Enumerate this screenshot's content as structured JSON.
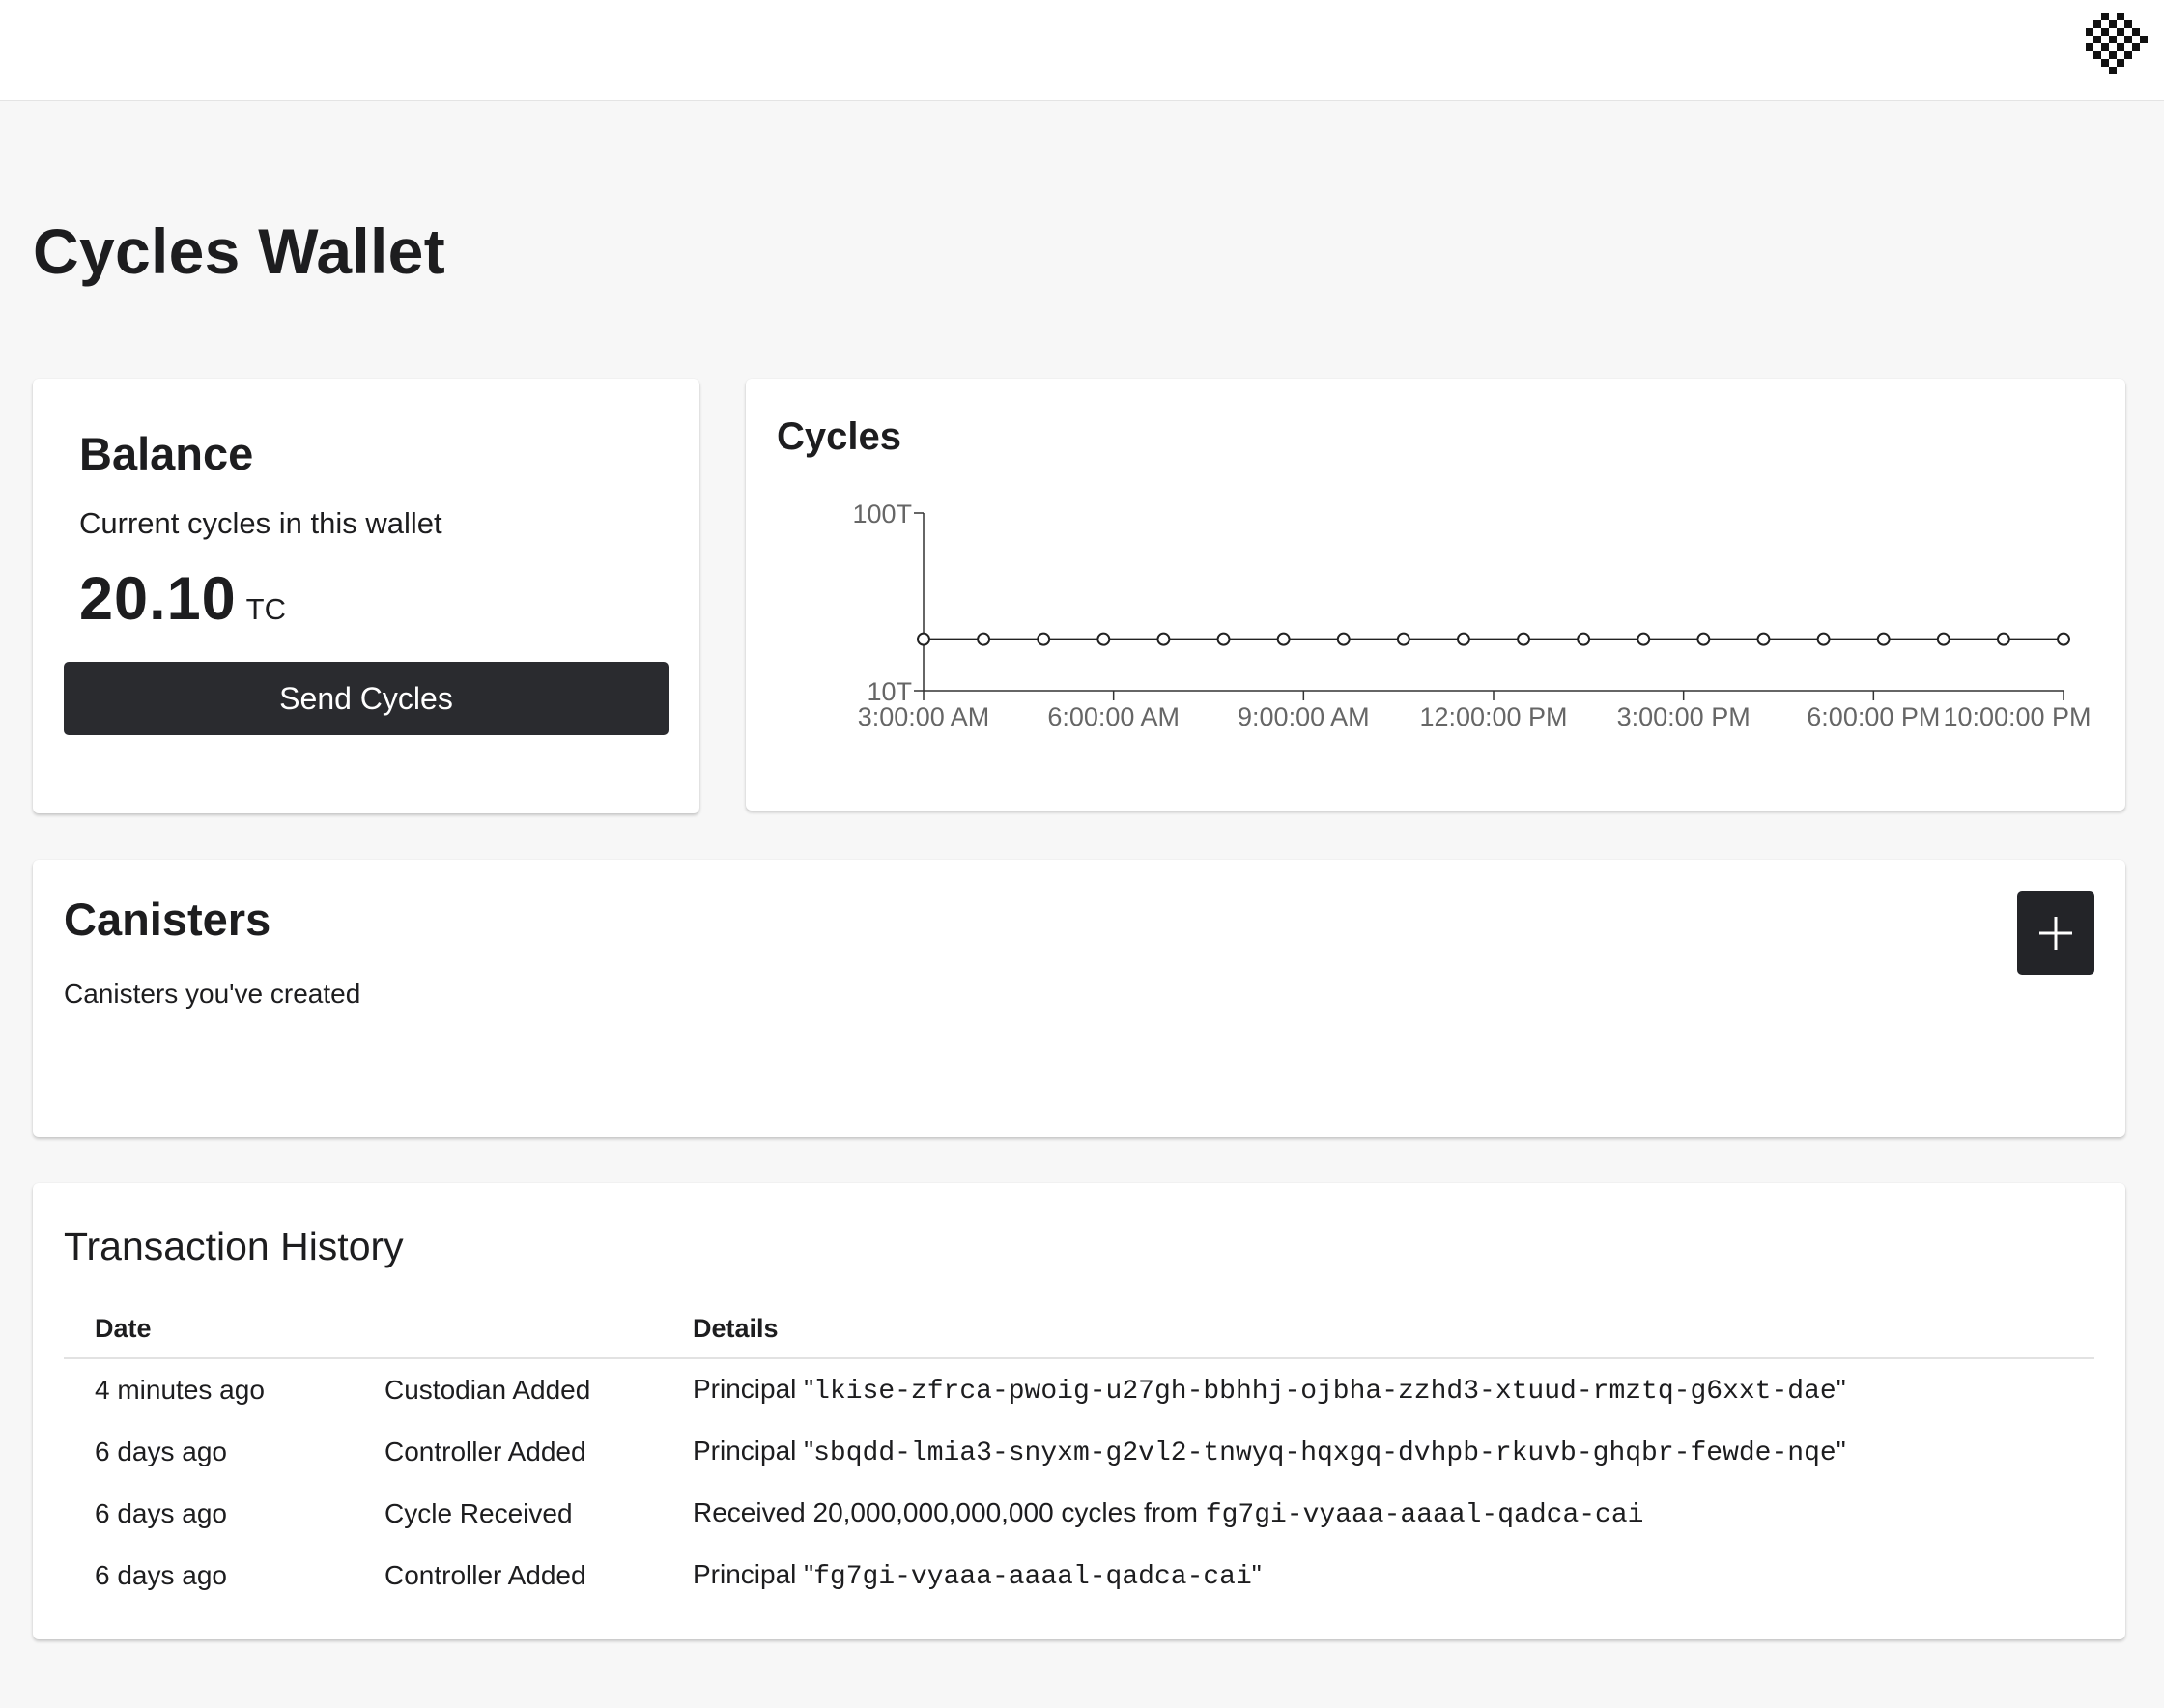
{
  "page": {
    "title": "Cycles Wallet"
  },
  "balance": {
    "title": "Balance",
    "subtitle": "Current cycles in this wallet",
    "amount": "20.10",
    "unit": "TC",
    "send_label": "Send Cycles"
  },
  "cycles_panel": {
    "title": "Cycles"
  },
  "chart_data": {
    "type": "line",
    "title": "Cycles",
    "x_ticks": [
      "3:00:00 AM",
      "6:00:00 AM",
      "9:00:00 AM",
      "12:00:00 PM",
      "3:00:00 PM",
      "6:00:00 PM",
      "10:00:00 PM"
    ],
    "y_ticks": [
      "10T",
      "100T"
    ],
    "y_scale": "log",
    "ylim": [
      10,
      100
    ],
    "series": [
      {
        "values": [
          20.1,
          20.1,
          20.1,
          20.1,
          20.1,
          20.1,
          20.1,
          20.1,
          20.1,
          20.1,
          20.1,
          20.1,
          20.1,
          20.1,
          20.1,
          20.1,
          20.1,
          20.1,
          20.1,
          20.1
        ]
      }
    ],
    "grid": false
  },
  "canisters": {
    "title": "Canisters",
    "subtitle": "Canisters you've created"
  },
  "history": {
    "title": "Transaction History",
    "headers": {
      "date": "Date",
      "type": "",
      "details": "Details"
    },
    "rows": [
      {
        "date": "4 minutes ago",
        "type": "Custodian Added",
        "prefix": "Principal \"",
        "code": "lkise-zfrca-pwoig-u27gh-bbhhj-ojbha-zzhd3-xtuud-rmztq-g6xxt-dae",
        "suffix": "\""
      },
      {
        "date": "6 days ago",
        "type": "Controller Added",
        "prefix": "Principal \"",
        "code": "sbqdd-lmia3-snyxm-g2vl2-tnwyq-hqxgq-dvhpb-rkuvb-ghqbr-fewde-nqe",
        "suffix": "\""
      },
      {
        "date": "6 days ago",
        "type": "Cycle Received",
        "prefix": "Received 20,000,000,000,000 cycles from ",
        "code": "fg7gi-vyaaa-aaaal-qadca-cai",
        "suffix": ""
      },
      {
        "date": "6 days ago",
        "type": "Controller Added",
        "prefix": "Principal \"",
        "code": "fg7gi-vyaaa-aaaal-qadca-cai",
        "suffix": "\""
      }
    ]
  }
}
